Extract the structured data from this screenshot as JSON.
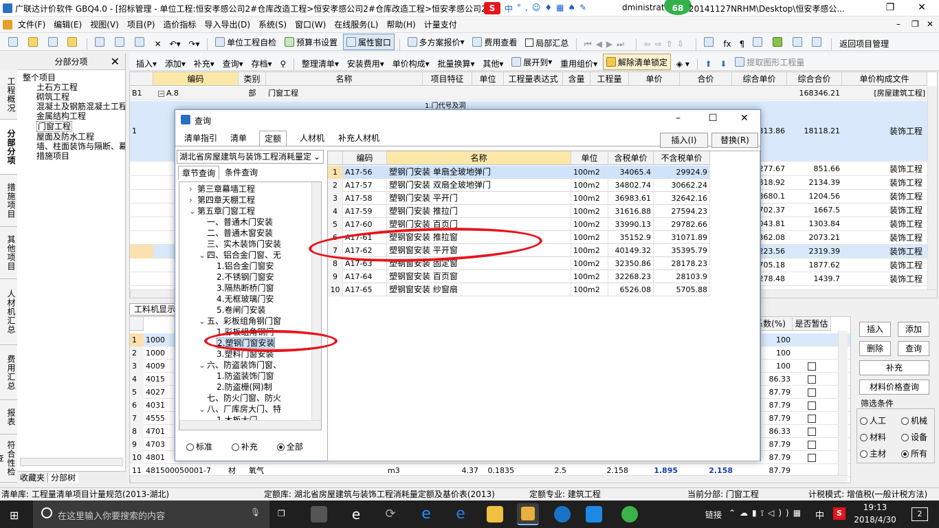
{
  "window": {
    "title": "广联达计价软件 GBQ4.0 - [招标管理 - 单位工程:恒安孝感公司2#仓库改造工程>恒安孝感公司2#仓库改造工程>恒安孝感公司2#",
    "title_right": "dministrato",
    "path_tail": "20141127NRHM\\Desktop\\恒安孝感公...",
    "badge": "68",
    "ime_label": "中"
  },
  "menu": [
    "文件(F)",
    "编辑(E)",
    "视图(V)",
    "项目(P)",
    "造价指标",
    "导入导出(D)",
    "系统(S)",
    "窗口(W)",
    "在线服务(L)",
    "帮助(H)",
    "计量支付"
  ],
  "toolbar1": [
    "单位工程自检",
    "预算书设置",
    "属性窗口",
    "多方案报价",
    "费用查看",
    "局部汇总",
    "返回项目管理"
  ],
  "toolbar2": [
    "插入",
    "添加",
    "补充",
    "查询",
    "存档",
    "整理清单",
    "安装费用",
    "单价构成",
    "批量换算",
    "其他",
    "展开到",
    "重用组价",
    "解除清单锁定",
    "提取图形工程量"
  ],
  "vtabs": [
    "工程概况",
    "分部分项",
    "措施项目",
    "其他项目",
    "人材机汇总",
    "费用汇总",
    "报表",
    "符合性检查"
  ],
  "tree": {
    "title": "分部分项",
    "items": [
      "整个项目",
      "土石方工程",
      "砌筑工程",
      "混凝土及钢筋混凝土工程",
      "金属结构工程",
      "门窗工程",
      "屋面及防水工程",
      "墙、柱面装饰与隔断、幕",
      "措施项目"
    ],
    "bottom_tabs": [
      "收藏夹",
      "分部树"
    ]
  },
  "main_grid": {
    "headers": [
      "编码",
      "类别",
      "名称",
      "项目特征",
      "单位",
      "工程量表达式",
      "含量",
      "工程量",
      "单价",
      "合价",
      "综合单价",
      "综合合价",
      "单价构成文件"
    ],
    "row_b1": {
      "no": "B1",
      "code": "A.8",
      "type": "部",
      "name": "门窗工程",
      "total": "168346.21",
      "file": "[房屋建筑工程]"
    },
    "row_1": {
      "no": "1",
      "feature": "1.门代号及洞",
      "unit_price": "313.86",
      "total": "18118.21",
      "file": "装饰工程"
    },
    "rows": [
      {
        "a": "277.67",
        "b": "851.66",
        "c": "装饰工程"
      },
      {
        "a": "818.92",
        "b": "2134.39",
        "c": "装饰工程"
      },
      {
        "a": "8680.1",
        "b": "1204.56",
        "c": "装饰工程"
      },
      {
        "a": "702.37",
        "b": "1667.5",
        "c": "装饰工程"
      },
      {
        "a": "043.81",
        "b": "1303.84",
        "c": "装饰工程"
      },
      {
        "a": "362.08",
        "b": "2073.21",
        "c": "装饰工程"
      },
      {
        "a": "223.56",
        "b": "2319.39",
        "c": "装饰工程"
      },
      {
        "a": "705.18",
        "b": "1877.62",
        "c": "装饰工程"
      },
      {
        "a": "278.48",
        "b": "1439.7",
        "c": "装饰工程"
      }
    ]
  },
  "bottom_grid": {
    "tab": "工料机显示",
    "headers": [
      "系数(%)",
      "是否暂估"
    ],
    "rows": [
      {
        "no": "1",
        "code": "1000",
        "pct": "100",
        "chk": false
      },
      {
        "no": "2",
        "code": "1000",
        "pct": "100",
        "chk": false
      },
      {
        "no": "3",
        "code": "4009",
        "pct": "100",
        "chk": true
      },
      {
        "no": "4",
        "code": "4015",
        "pct": "86.33",
        "chk": true
      },
      {
        "no": "5",
        "code": "4027",
        "pct": "87.79",
        "chk": true
      },
      {
        "no": "6",
        "code": "4031",
        "pct": "87.79",
        "chk": true
      },
      {
        "no": "7",
        "code": "4555",
        "pct": "87.79",
        "chk": true
      },
      {
        "no": "8",
        "code": "4701",
        "pct": "86.33",
        "chk": true
      },
      {
        "no": "9",
        "code": "4703",
        "pct": "87.79",
        "chk": true
      },
      {
        "no": "10",
        "code": "4801",
        "pct": "87.79",
        "chk": true
      }
    ],
    "last_row": {
      "no": "11",
      "code": "481500050001-7",
      "type": "材",
      "name": "氧气",
      "unit": "m3",
      "v1": "4.37",
      "v2": "0.1835",
      "v3": "2.5",
      "v4": "2.158",
      "v5": "1.895",
      "v6": "2.158",
      "pct": "87.79"
    }
  },
  "right_panel": {
    "buttons": [
      "插入",
      "添加",
      "删除",
      "查询",
      "补充",
      "材料价格查询"
    ],
    "filter_title": "筛选条件",
    "filters": [
      {
        "label": "人工",
        "on": false
      },
      {
        "label": "机械",
        "on": false
      },
      {
        "label": "材料",
        "on": false
      },
      {
        "label": "设备",
        "on": false
      },
      {
        "label": "主材",
        "on": false
      },
      {
        "label": "所有",
        "on": true
      }
    ]
  },
  "dialog": {
    "title": "查询",
    "tabs": [
      "清单指引",
      "清单",
      "定额",
      "人材机",
      "补充人材机"
    ],
    "active_tab": "定额",
    "insert_label": "插入(I)",
    "replace_label": "替换(R)",
    "library": "湖北省房屋建筑与装饰工程消耗量定",
    "subtabs": [
      "章节查询",
      "条件查询"
    ],
    "tree": [
      "第三章幕墙工程",
      "第四章天棚工程",
      "第五章门窗工程",
      "一、普通木门安装",
      "二、普通木窗安装",
      "三、实木装饰门安装",
      "四、铝合金门窗、无",
      "1.铝合金门窗安",
      "2.不锈钢门窗安",
      "3.隔热断桥门窗",
      "4.无框玻璃门安",
      "5.卷闸门安装",
      "五、彩板组角钢门窗",
      "1.彩板组角钢门",
      "2.塑钢门窗安装",
      "3.塑料门窗安装",
      "六、防盗装饰门窗、",
      "1.防盗装饰门窗",
      "2.防盗栅(网)制",
      "七、防火门窗、防火",
      "八、厂库房大门、特",
      "1.木板大门"
    ],
    "radios": [
      {
        "label": "标准",
        "on": false
      },
      {
        "label": "补充",
        "on": false
      },
      {
        "label": "全部",
        "on": true
      }
    ],
    "headers": [
      "编码",
      "名称",
      "单位",
      "含税单价",
      "不含税单价"
    ],
    "rows": [
      {
        "no": "1",
        "code": "A17-56",
        "name": "塑钢门安装 单扇全玻地弹门",
        "unit": "100m2",
        "tax": "34065.4",
        "notax": "29924.9"
      },
      {
        "no": "2",
        "code": "A17-57",
        "name": "塑钢门安装 双扇全玻地弹门",
        "unit": "100m2",
        "tax": "34802.74",
        "notax": "30662.24"
      },
      {
        "no": "3",
        "code": "A17-58",
        "name": "塑钢门安装 平开门",
        "unit": "100m2",
        "tax": "36983.61",
        "notax": "32642.16"
      },
      {
        "no": "4",
        "code": "A17-59",
        "name": "塑钢门安装 推拉门",
        "unit": "100m2",
        "tax": "31616.88",
        "notax": "27594.23"
      },
      {
        "no": "5",
        "code": "A17-60",
        "name": "塑钢门安装 百页门",
        "unit": "100m2",
        "tax": "33990.13",
        "notax": "29782.66"
      },
      {
        "no": "6",
        "code": "A17-61",
        "name": "塑钢窗安装 推拉窗",
        "unit": "100m2",
        "tax": "35152.9",
        "notax": "31071.89"
      },
      {
        "no": "7",
        "code": "A17-62",
        "name": "塑钢窗安装 平开窗",
        "unit": "100m2",
        "tax": "40149.32",
        "notax": "35395.79"
      },
      {
        "no": "8",
        "code": "A17-63",
        "name": "塑钢窗安装 固定窗",
        "unit": "100m2",
        "tax": "32350.86",
        "notax": "28178.23"
      },
      {
        "no": "9",
        "code": "A17-64",
        "name": "塑钢窗安装 百页窗",
        "unit": "100m2",
        "tax": "32268.23",
        "notax": "28103.9"
      },
      {
        "no": "10",
        "code": "A17-65",
        "name": "塑钢窗安装 纱窗扇",
        "unit": "100m2",
        "tax": "6526.08",
        "notax": "5705.88"
      }
    ]
  },
  "status": {
    "list_lib": "清单库: 工程量清单项目计量规范(2013-湖北)",
    "quota_lib": "定额库: 湖北省房屋建筑与装饰工程消耗量定额及基价表(2013)",
    "quota_major": "定额专业: 建筑工程",
    "current": "当前分部: 门窗工程",
    "tax_mode": "计税模式: 增值税(一般计税方法)"
  },
  "taskbar": {
    "search_placeholder": "在这里输入你要搜索的内容",
    "link": "链接",
    "ime": "中",
    "time": "19:13",
    "date": "2018/4/30",
    "notify": "2"
  }
}
